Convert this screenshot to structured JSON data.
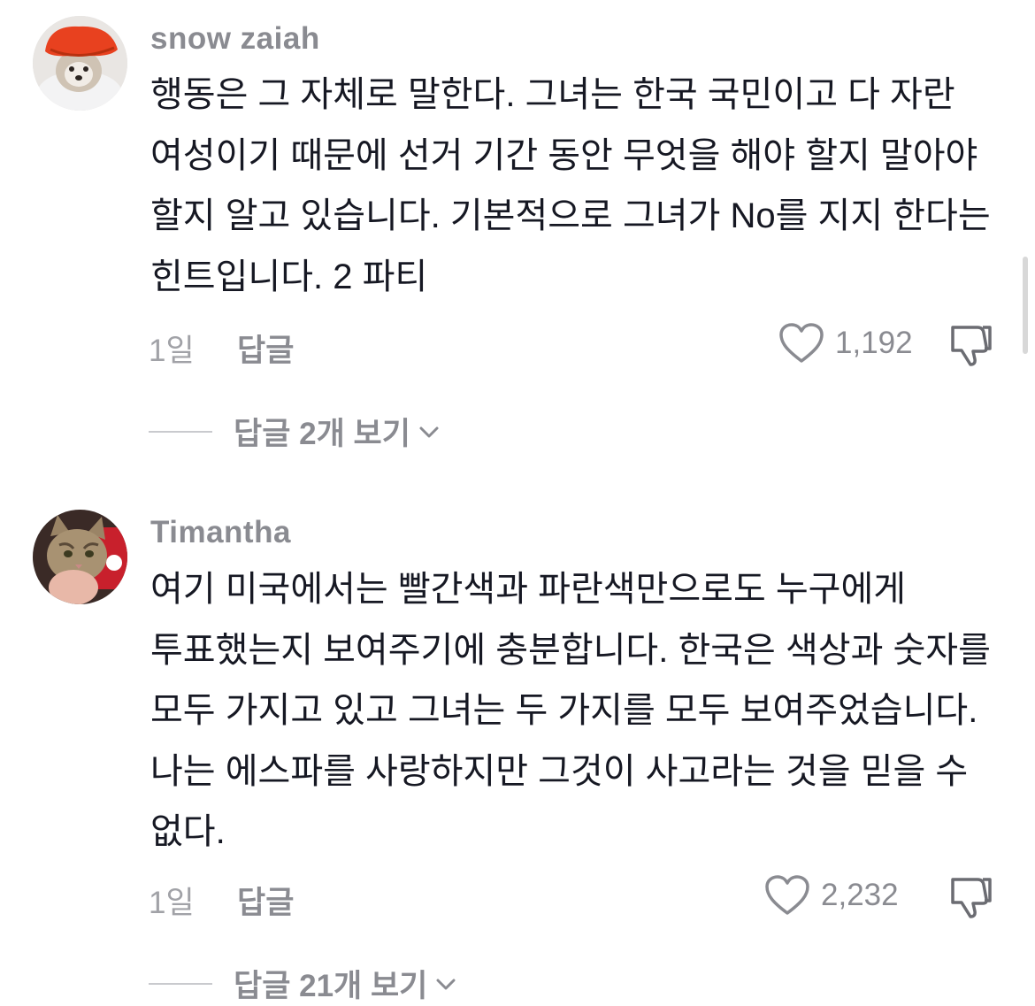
{
  "comments": [
    {
      "username": "snow zaiah",
      "text": "행동은 그 자체로 말한다. 그녀는 한국 국민이고 다 자란 여성이기 때문에 선거 기간 동안 무엇을 해야 할지 말아야 할지 알고 있습니다. 기본적으로 그녀가 No를 지지 한다는 힌트입니다. 2 파티",
      "time": "1일",
      "reply_label": "답글",
      "likes": "1,192",
      "view_replies": "답글 2개 보기",
      "avatar_icon": "dog-in-red-hat-avatar"
    },
    {
      "username": "Timantha",
      "text": "여기 미국에서는 빨간색과 파란색만으로도 누구에게 투표했는지 보여주기에 충분합니다. 한국은 색상과 숫자를 모두 가지고 있고 그녀는 두 가지를 모두 보여주었습니다. 나는 에스파를 사랑하지만 그것이 사고라는 것을 믿을 수 없다.",
      "time": "1일",
      "reply_label": "답글",
      "likes": "2,232",
      "view_replies": "답글 21개 보기",
      "avatar_icon": "cat-avatar"
    }
  ],
  "colors": {
    "username": "#8a8b91",
    "body": "#161823",
    "meta": "#a1a2a7",
    "background": "#ffffff"
  }
}
